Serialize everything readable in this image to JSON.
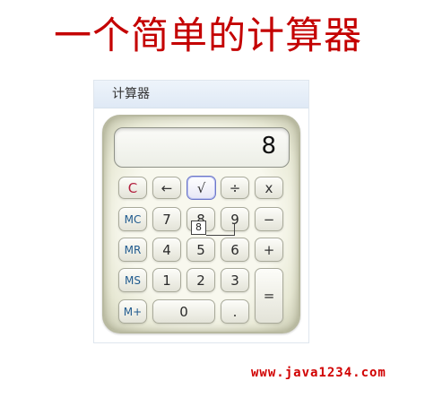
{
  "heading": "一个简单的计算器",
  "window": {
    "title": "计算器"
  },
  "display": {
    "value": "8"
  },
  "buttons": {
    "clear": "C",
    "back": "←",
    "sqrt": "√",
    "divide": "÷",
    "multiply": "x",
    "mc": "MC",
    "mr": "MR",
    "ms": "MS",
    "mplus": "M+",
    "minus": "−",
    "plus": "+",
    "equals": "=",
    "zero": "0",
    "dot": ".",
    "seven": "7",
    "eight": "8",
    "nine": "9",
    "four": "4",
    "five": "5",
    "six": "6",
    "one": "1",
    "two": "2",
    "three": "3"
  },
  "drag_ghost": "8",
  "watermark": "www.java1234.com",
  "colors": {
    "heading": "#c40000",
    "memory_keys": "#1f5a8e",
    "clear_key": "#b3203f",
    "active_key_border": "#6e78c8",
    "watermark": "#d10000"
  }
}
